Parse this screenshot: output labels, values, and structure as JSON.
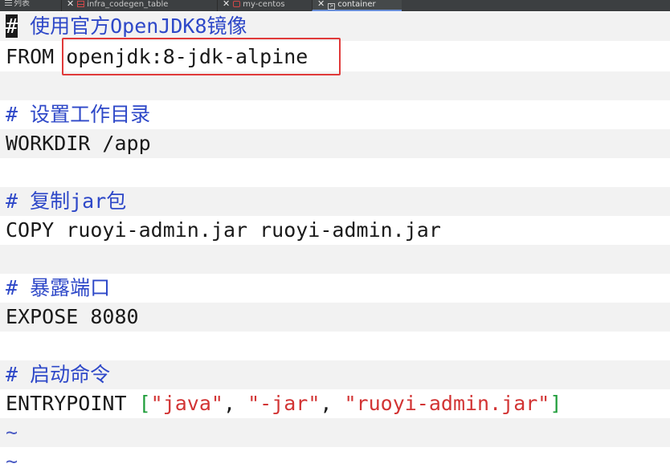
{
  "tabs": [
    {
      "name": "tab-list",
      "icon": "menu-icon",
      "label": "列表",
      "closable": false
    },
    {
      "name": "tab-infra-codegen-table",
      "icon": "table-icon",
      "label": "infra_codegen_table",
      "closable": true
    },
    {
      "name": "tab-my-centos",
      "icon": "database-icon",
      "label": "my-centos",
      "closable": true
    },
    {
      "name": "tab-container",
      "icon": "terminal-icon",
      "label": "container",
      "closable": true,
      "active": true
    }
  ],
  "editor": {
    "lines": [
      {
        "comment_hash": "#",
        "comment_text": " 使用官方OpenJDK8镜像"
      },
      {
        "keyword": "FROM",
        "arg": "openjdk:8-jdk-alpine"
      },
      {},
      {
        "comment_hash": "#",
        "comment_text": " 设置工作目录"
      },
      {
        "keyword": "WORKDIR",
        "arg": "/app"
      },
      {},
      {
        "comment_hash": "#",
        "comment_text": " 复制jar包"
      },
      {
        "keyword": "COPY",
        "arg": "ruoyi-admin.jar ruoyi-admin.jar"
      },
      {},
      {
        "comment_hash": "#",
        "comment_text": " 暴露端口"
      },
      {
        "keyword": "EXPOSE",
        "arg": "8080"
      },
      {},
      {
        "comment_hash": "#",
        "comment_text": " 启动命令"
      },
      {
        "keyword": "ENTRYPOINT",
        "open": "[",
        "s1": "\"java\"",
        "sep1": ", ",
        "s2": "\"-jar\"",
        "sep2": ", ",
        "s3": "\"ruoyi-admin.jar\"",
        "close": "]"
      },
      {
        "tilde": "~"
      },
      {
        "tilde": "~"
      }
    ]
  },
  "colors": {
    "comment": "#2e48c8",
    "string": "#d23434",
    "bracket": "#1f9d3a",
    "highlight_box": "#e03a3a",
    "active_tab_underline": "#6a8fd8"
  }
}
